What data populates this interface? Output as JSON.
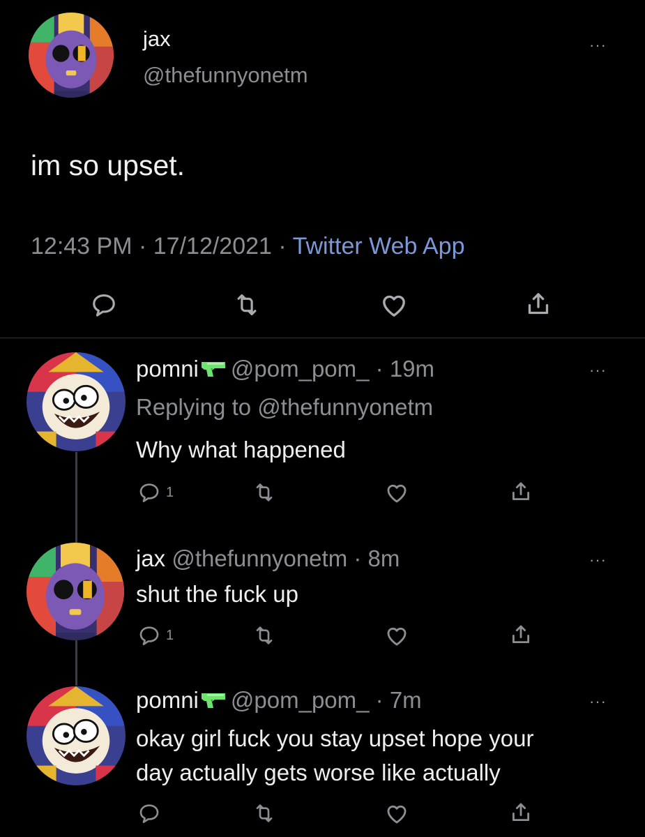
{
  "main_tweet": {
    "name": "jax",
    "handle": "@thefunnyonetm",
    "text": "im so upset.",
    "time": "12:43 PM",
    "date": "17/12/2021",
    "separator": "·",
    "source": "Twitter Web App",
    "more": "···"
  },
  "replies": [
    {
      "name": "pomni",
      "handle": "@pom_pom_",
      "age": "19m",
      "replying_label": "Replying to",
      "replying_handle": "@thefunnyonetm",
      "text": "Why what happened",
      "reply_count": "1",
      "more": "···",
      "has_gun_emoji": true
    },
    {
      "name": "jax",
      "handle": "@thefunnyonetm",
      "age": "8m",
      "text": "shut the fuck up",
      "reply_count": "1",
      "more": "···"
    },
    {
      "name": "pomni",
      "handle": "@pom_pom_",
      "age": "7m",
      "text_line1": "okay girl fuck you stay upset hope your",
      "text_line2": "day actually gets worse like actually",
      "reply_count": "",
      "more": "···",
      "has_gun_emoji": true
    }
  ],
  "colors": {
    "background": "#000000",
    "text": "#e7e9ea",
    "muted": "#8b8f94",
    "link": "#7d98d6",
    "gun_emoji": "#6fe36f"
  },
  "icons": [
    "reply-icon",
    "retweet-icon",
    "like-icon",
    "share-icon",
    "more-icon",
    "water-gun-emoji"
  ]
}
